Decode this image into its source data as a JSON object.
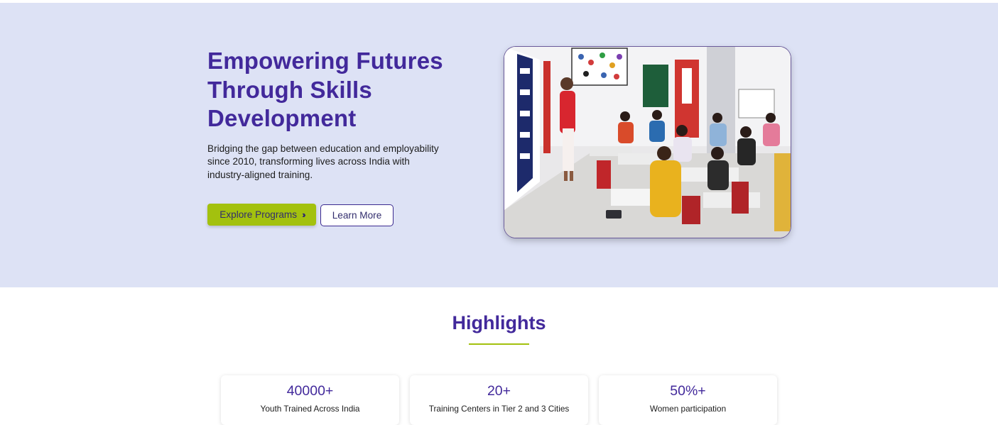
{
  "hero": {
    "title": "Empowering Futures Through Skills Development",
    "description": "Bridging the gap between education and employability since 2010, transforming lives across India with industry-aligned training.",
    "primary_button": "Explore Programs",
    "primary_button_icon": "double-chevron-right-icon",
    "secondary_button": "Learn More",
    "photo": "classroom-training-photo"
  },
  "highlights": {
    "title": "Highlights",
    "cards": [
      {
        "value": "40000+",
        "label": "Youth Trained Across India"
      },
      {
        "value": "20+",
        "label": "Training Centers in Tier 2 and 3 Cities"
      },
      {
        "value": "50%+",
        "label": "Women participation"
      }
    ]
  },
  "colors": {
    "hero_bg": "#dde2f5",
    "brand_purple": "#42299b",
    "accent_green": "#a3c10e"
  }
}
